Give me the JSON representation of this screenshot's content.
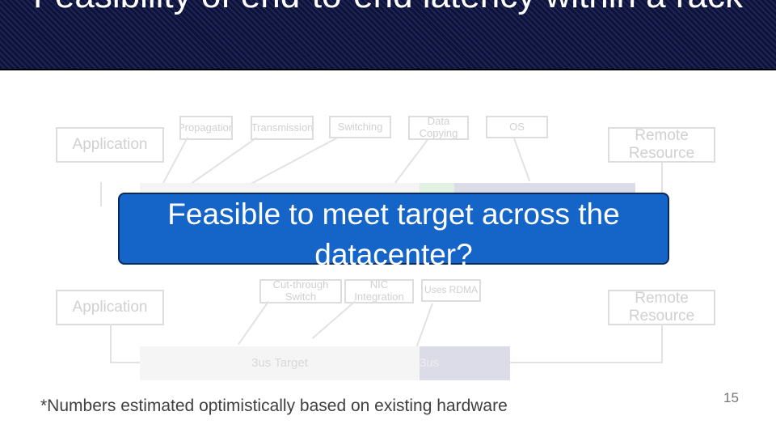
{
  "title": "Feasibility of end-to-end latency within a rack",
  "top": {
    "application": "Application",
    "remote": "Remote Resource",
    "components": [
      "Propagation",
      "Transmission",
      "Switching",
      "Data Copying",
      "OS"
    ]
  },
  "bottom": {
    "application": "Application",
    "remote": "Remote Resource",
    "components": [
      "Cut-through Switch",
      "NIC Integration",
      "Uses RDMA"
    ],
    "os_label": "OS",
    "target_label": "3us Target",
    "total_label": "3us"
  },
  "callout": "Feasible to meet target across the datacenter?",
  "footnote": "*Numbers estimated optimistically based on existing hardware",
  "page_number": "15",
  "colors": {
    "title_bg": "#0d1236",
    "callout_bg": "#1565c8"
  }
}
